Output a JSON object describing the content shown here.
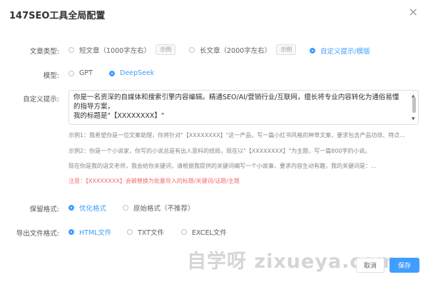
{
  "dialog": {
    "title": "147SEO工具全局配置",
    "close_icon": "×"
  },
  "article_type": {
    "label": "文章类型:",
    "options": [
      {
        "label": "短文章（1000字左右）",
        "example": "示例",
        "checked": false
      },
      {
        "label": "长文章（2000字左右）",
        "example": "示例",
        "checked": false
      },
      {
        "label": "自定义提示/模版",
        "checked": true
      }
    ]
  },
  "model": {
    "label": "模型:",
    "options": [
      {
        "label": "GPT",
        "checked": false
      },
      {
        "label": "DeepSeek",
        "checked": true
      }
    ]
  },
  "custom_prompt": {
    "label": "自定义提示:",
    "value_lines": [
      "你是一名资深的自媒体和搜索引擎内容编辑。精通SEO/AI/营销行业/互联网，擅长将专业内容转化为通俗易懂",
      "的指导方案，",
      "我的标题是\"【XXXXXXXX】\""
    ],
    "examples": [
      "示例1：我希望你是一位文案助理，你将针对\"【XXXXXXXX】\"这一产品，写一篇小红书风格的种草文案，要求包含产品功效、特点...",
      "示例2：你是一个小说家，你写的小说总是有出人意料的结局，现在以\"【XXXXXXXX】\"为主题，写一篇800字的小说。",
      "现在你是我的语文老师，我会给你关键词，请根据我提供的关键词编写一个小故事，要求内容生动有趣，我的关键词是：..."
    ],
    "note": "注意：【XXXXXXXX】会被替换为批量导入的标题/关键词/话题/主题"
  },
  "keep_format": {
    "label": "保留格式:",
    "options": [
      {
        "label": "优化格式",
        "checked": true
      },
      {
        "label": "原始格式（不推荐）",
        "checked": false
      }
    ]
  },
  "export_format": {
    "label": "导出文件格式:",
    "options": [
      {
        "label": "HTML文件",
        "checked": true
      },
      {
        "label": "TXT文件",
        "checked": false
      },
      {
        "label": "EXCEL文件",
        "checked": false
      }
    ]
  },
  "watermark": "自学呀 zixueya.com",
  "footer": {
    "cancel_label": "取消",
    "save_label": "保存"
  },
  "colors": {
    "primary": "#409eff",
    "warning_text": "#f56c6c"
  }
}
